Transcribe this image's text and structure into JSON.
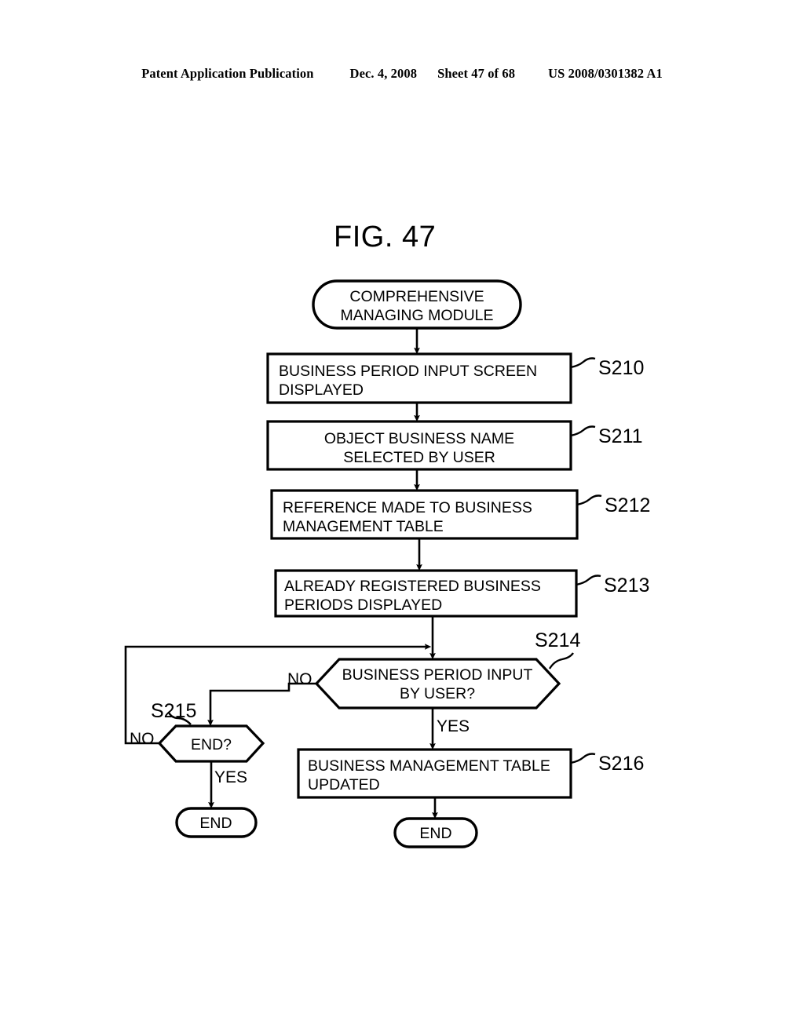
{
  "header": {
    "publication": "Patent Application Publication",
    "date": "Dec. 4, 2008",
    "sheet": "Sheet 47 of 68",
    "patent_number": "US 2008/0301382 A1"
  },
  "figure": {
    "title": "FIG. 47"
  },
  "flowchart": {
    "start_terminator": {
      "line1": "COMPREHENSIVE",
      "line2": "MANAGING MODULE"
    },
    "steps": [
      {
        "id": "S210",
        "label": "S210",
        "line1": "BUSINESS PERIOD INPUT SCREEN",
        "line2": "DISPLAYED"
      },
      {
        "id": "S211",
        "label": "S211",
        "line1": "OBJECT BUSINESS NAME",
        "line2": "SELECTED BY USER"
      },
      {
        "id": "S212",
        "label": "S212",
        "line1": "REFERENCE MADE TO BUSINESS",
        "line2": "MANAGEMENT TABLE"
      },
      {
        "id": "S213",
        "label": "S213",
        "line1": "ALREADY REGISTERED BUSINESS",
        "line2": "PERIODS DISPLAYED"
      },
      {
        "id": "S216",
        "label": "S216",
        "line1": "BUSINESS MANAGEMENT TABLE",
        "line2": "UPDATED"
      }
    ],
    "decisions": [
      {
        "id": "S214",
        "label": "S214",
        "line1": "BUSINESS PERIOD INPUT",
        "line2": "BY USER?",
        "no_label": "NO",
        "yes_label": "YES"
      },
      {
        "id": "S215",
        "label": "S215",
        "line1": "END?",
        "no_label": "NO",
        "yes_label": "YES"
      }
    ],
    "end_terminators": [
      {
        "id": "end-left",
        "text": "END"
      },
      {
        "id": "end-right",
        "text": "END"
      }
    ]
  }
}
